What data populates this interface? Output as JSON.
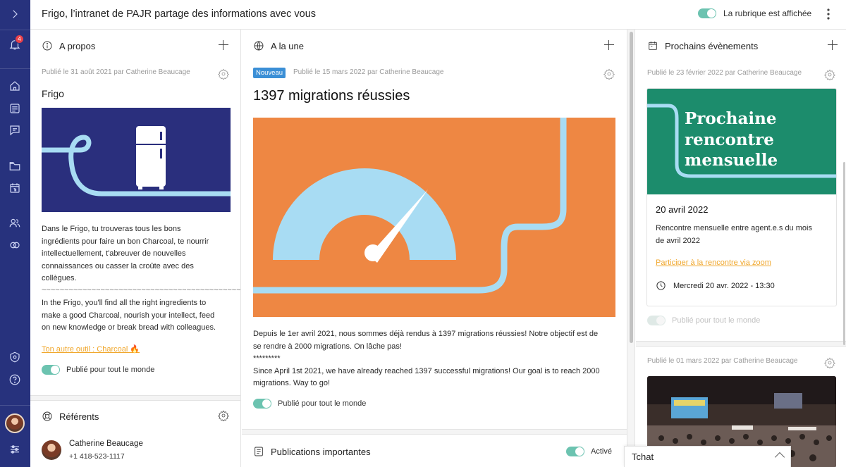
{
  "topbar": {
    "title": "Frigo, l’intranet de PAJR partage des informations avec vous",
    "shown_label": "La rubrique est affichée"
  },
  "rail": {
    "notification_count": "4"
  },
  "apropos": {
    "header": "A propos",
    "meta": "Publié le 31 août 2021 par Catherine Beaucage",
    "title": "Frigo",
    "text_fr_1": "Dans le Frigo, tu trouveras tous les bons",
    "text_fr_2": "ingrédients pour faire un bon Charcoal, te nourrir",
    "text_fr_3": "intellectuellement, t'abreuver de nouvelles",
    "text_fr_4": "connaissances ou casser la croûte avec des",
    "text_fr_5": "collègues.",
    "separator": "~~~~~~~~~~~~~~~~~~~~~~~~~~~~~~~~~~~~~~~~~~~~~~~~~~~~~~~~~~~~~~~~~",
    "text_en_1": "In the Frigo, you'll find all the right ingredients to",
    "text_en_2": "make a good Charcoal, nourish your intellect, feed",
    "text_en_3": "on new knowledge or break bread with colleagues.",
    "link": "Ton autre outil : Charcoal 🔥",
    "published": "Publié pour tout le monde"
  },
  "referents": {
    "header": "Référents",
    "person_name": "Catherine Beaucage",
    "person_phone": "+1 418-523-1117"
  },
  "alaune": {
    "header": "A la une",
    "badge": "Nouveau",
    "meta": "Publié le 15 mars 2022 par Catherine Beaucage",
    "title": "1397 migrations réussies",
    "text_1": "Depuis le 1er avril 2021, nous sommes déjà rendus à 1397 migrations réussies! Notre objectif est de",
    "text_2": "se rendre à 2000 migrations. On lâche pas!",
    "text_3": "*********",
    "text_4": "Since April 1st 2021, we have already reached 1397 successful migrations! Our goal is to reach 2000",
    "text_5": "migrations. Way to go!",
    "published": "Publié pour tout le monde"
  },
  "publications": {
    "header": "Publications importantes",
    "status": "Activé"
  },
  "events": {
    "header": "Prochains évènements",
    "meta_1": "Publié le 23 février 2022 par Catherine Beaucage",
    "banner_1": "Prochaine",
    "banner_2": "rencontre",
    "banner_3": "mensuelle",
    "date": "20 avril 2022",
    "desc_1": "Rencontre mensuelle entre agent.e.s du mois",
    "desc_2": "de avril 2022",
    "link": "Participer à la rencontre via zoom",
    "time": "Mercredi 20 avr. 2022 - 13:30",
    "published": "Publié pour tout le monde",
    "meta_2": "Publié le 01 mars 2022 par Catherine Beaucage"
  },
  "tchat": {
    "label": "Tchat"
  },
  "colors": {
    "rail": "#27327d",
    "accent_toggle": "#6cc3b0",
    "link": "#f0a72c",
    "navy_image": "#2a2f7d",
    "orange_image": "#ee8743",
    "green_banner": "#1c8c6c",
    "light_blue": "#a8dcf3"
  }
}
